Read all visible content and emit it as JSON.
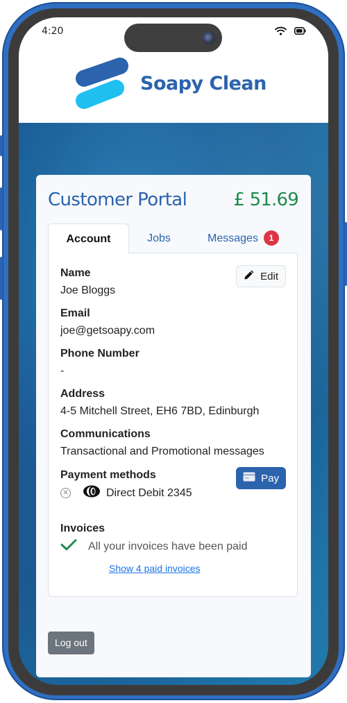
{
  "status_bar": {
    "time": "4:20",
    "icons": [
      "wifi-icon",
      "battery-icon"
    ]
  },
  "brand": {
    "name": "Soapy Clean",
    "logo_colors": [
      "#2b63ad",
      "#1fc0ef"
    ]
  },
  "portal": {
    "title": "Customer Portal",
    "balance": "£ 51.69",
    "colors": {
      "primary": "#2b63ad",
      "balance": "#1e8a4c",
      "badge": "#dc3545"
    }
  },
  "tabs": [
    {
      "label": "Account",
      "active": true
    },
    {
      "label": "Jobs",
      "active": false
    },
    {
      "label": "Messages",
      "active": false,
      "badge": "1"
    }
  ],
  "account": {
    "edit_label": "Edit",
    "fields": [
      {
        "label": "Name",
        "value": "Joe Bloggs"
      },
      {
        "label": "Email",
        "value": "joe@getsoapy.com"
      },
      {
        "label": "Phone Number",
        "value": "-"
      },
      {
        "label": "Address",
        "value": "4-5 Mitchell Street, EH6 7BD, Edinburgh"
      },
      {
        "label": "Communications",
        "value": "Transactional and Promotional messages"
      }
    ],
    "payment": {
      "label": "Payment methods",
      "pay_label": "Pay",
      "methods": [
        {
          "name": "Direct Debit 2345",
          "icon": "direct-debit-icon"
        }
      ]
    },
    "invoices": {
      "label": "Invoices",
      "status": "All your invoices have been paid",
      "link": "Show 4 paid invoices"
    }
  },
  "logout_label": "Log out"
}
